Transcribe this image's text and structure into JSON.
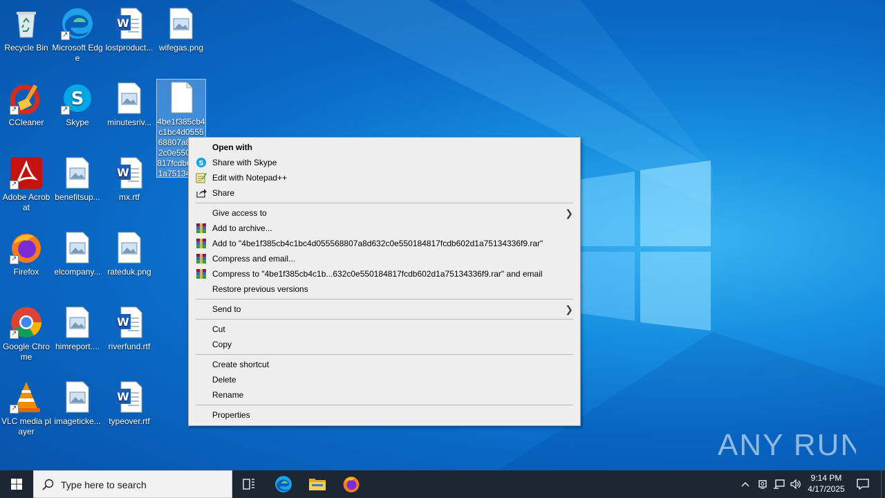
{
  "desktop": {
    "icons": [
      {
        "label": "Recycle Bin",
        "icon": "recycle-bin-icon"
      },
      {
        "label": "Microsoft Edge",
        "icon": "edge-icon"
      },
      {
        "label": "lostproduct...",
        "icon": "word-doc-icon"
      },
      {
        "label": "wifegas.png",
        "icon": "image-file-icon"
      },
      {
        "label": "CCleaner",
        "icon": "ccleaner-icon"
      },
      {
        "label": "Skype",
        "icon": "skype-icon"
      },
      {
        "label": "minutesriv...",
        "icon": "image-file-icon"
      },
      {
        "label": "4be1f385cb4c1bc4d055568807a8d632c0e550184817fcdb602d1a75134336",
        "icon": "blank-file-icon"
      },
      {
        "label": "Adobe Acrobat",
        "icon": "acrobat-icon"
      },
      {
        "label": "benefitsup...",
        "icon": "image-file-icon"
      },
      {
        "label": "mx.rtf",
        "icon": "word-doc-icon"
      },
      {
        "label": "Firefox",
        "icon": "firefox-icon"
      },
      {
        "label": "elcompany...",
        "icon": "image-file-icon"
      },
      {
        "label": "rateduk.png",
        "icon": "image-file-icon"
      },
      {
        "label": "Google Chrome",
        "icon": "chrome-icon"
      },
      {
        "label": "himreport....",
        "icon": "image-file-icon"
      },
      {
        "label": "riverfund.rtf",
        "icon": "word-doc-icon"
      },
      {
        "label": "VLC media player",
        "icon": "vlc-icon"
      },
      {
        "label": "imageticke...",
        "icon": "image-file-icon"
      },
      {
        "label": "typeover.rtf",
        "icon": "word-doc-icon"
      }
    ]
  },
  "context_menu": {
    "open_with": "Open with",
    "share_skype": "Share with Skype",
    "edit_notepad": "Edit with Notepad++",
    "share": "Share",
    "give_access": "Give access to",
    "add_archive": "Add to archive...",
    "add_to_rar": "Add to \"4be1f385cb4c1bc4d055568807a8d632c0e550184817fcdb602d1a75134336f9.rar\"",
    "compress_email": "Compress and email...",
    "compress_to_rar_email": "Compress to \"4be1f385cb4c1b...632c0e550184817fcdb602d1a75134336f9.rar\" and email",
    "restore_versions": "Restore previous versions",
    "send_to": "Send to",
    "cut": "Cut",
    "copy": "Copy",
    "create_shortcut": "Create shortcut",
    "delete": "Delete",
    "rename": "Rename",
    "properties": "Properties"
  },
  "taskbar": {
    "search_placeholder": "Type here to search",
    "time": "9:14 PM",
    "date": "4/17/2025"
  },
  "watermark": "ANY RUN",
  "colors": {
    "accent": "#0078d7",
    "taskbar": "#1c2733",
    "menu_bg": "#eeeeee"
  }
}
